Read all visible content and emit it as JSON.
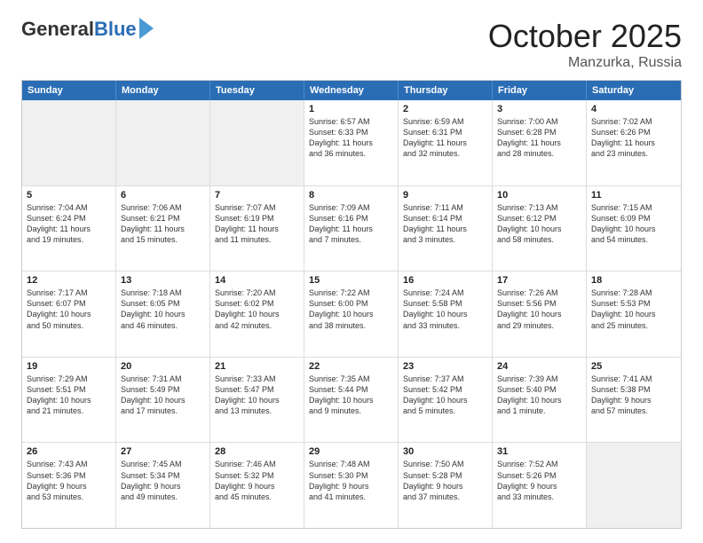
{
  "header": {
    "logo_general": "General",
    "logo_blue": "Blue",
    "title": "October 2025",
    "location": "Manzurka, Russia"
  },
  "weekdays": [
    "Sunday",
    "Monday",
    "Tuesday",
    "Wednesday",
    "Thursday",
    "Friday",
    "Saturday"
  ],
  "weeks": [
    [
      {
        "day": "",
        "text": "",
        "shaded": true
      },
      {
        "day": "",
        "text": "",
        "shaded": true
      },
      {
        "day": "",
        "text": "",
        "shaded": true
      },
      {
        "day": "1",
        "text": "Sunrise: 6:57 AM\nSunset: 6:33 PM\nDaylight: 11 hours\nand 36 minutes."
      },
      {
        "day": "2",
        "text": "Sunrise: 6:59 AM\nSunset: 6:31 PM\nDaylight: 11 hours\nand 32 minutes."
      },
      {
        "day": "3",
        "text": "Sunrise: 7:00 AM\nSunset: 6:28 PM\nDaylight: 11 hours\nand 28 minutes."
      },
      {
        "day": "4",
        "text": "Sunrise: 7:02 AM\nSunset: 6:26 PM\nDaylight: 11 hours\nand 23 minutes."
      }
    ],
    [
      {
        "day": "5",
        "text": "Sunrise: 7:04 AM\nSunset: 6:24 PM\nDaylight: 11 hours\nand 19 minutes."
      },
      {
        "day": "6",
        "text": "Sunrise: 7:06 AM\nSunset: 6:21 PM\nDaylight: 11 hours\nand 15 minutes."
      },
      {
        "day": "7",
        "text": "Sunrise: 7:07 AM\nSunset: 6:19 PM\nDaylight: 11 hours\nand 11 minutes."
      },
      {
        "day": "8",
        "text": "Sunrise: 7:09 AM\nSunset: 6:16 PM\nDaylight: 11 hours\nand 7 minutes."
      },
      {
        "day": "9",
        "text": "Sunrise: 7:11 AM\nSunset: 6:14 PM\nDaylight: 11 hours\nand 3 minutes."
      },
      {
        "day": "10",
        "text": "Sunrise: 7:13 AM\nSunset: 6:12 PM\nDaylight: 10 hours\nand 58 minutes."
      },
      {
        "day": "11",
        "text": "Sunrise: 7:15 AM\nSunset: 6:09 PM\nDaylight: 10 hours\nand 54 minutes."
      }
    ],
    [
      {
        "day": "12",
        "text": "Sunrise: 7:17 AM\nSunset: 6:07 PM\nDaylight: 10 hours\nand 50 minutes."
      },
      {
        "day": "13",
        "text": "Sunrise: 7:18 AM\nSunset: 6:05 PM\nDaylight: 10 hours\nand 46 minutes."
      },
      {
        "day": "14",
        "text": "Sunrise: 7:20 AM\nSunset: 6:02 PM\nDaylight: 10 hours\nand 42 minutes."
      },
      {
        "day": "15",
        "text": "Sunrise: 7:22 AM\nSunset: 6:00 PM\nDaylight: 10 hours\nand 38 minutes."
      },
      {
        "day": "16",
        "text": "Sunrise: 7:24 AM\nSunset: 5:58 PM\nDaylight: 10 hours\nand 33 minutes."
      },
      {
        "day": "17",
        "text": "Sunrise: 7:26 AM\nSunset: 5:56 PM\nDaylight: 10 hours\nand 29 minutes."
      },
      {
        "day": "18",
        "text": "Sunrise: 7:28 AM\nSunset: 5:53 PM\nDaylight: 10 hours\nand 25 minutes."
      }
    ],
    [
      {
        "day": "19",
        "text": "Sunrise: 7:29 AM\nSunset: 5:51 PM\nDaylight: 10 hours\nand 21 minutes."
      },
      {
        "day": "20",
        "text": "Sunrise: 7:31 AM\nSunset: 5:49 PM\nDaylight: 10 hours\nand 17 minutes."
      },
      {
        "day": "21",
        "text": "Sunrise: 7:33 AM\nSunset: 5:47 PM\nDaylight: 10 hours\nand 13 minutes."
      },
      {
        "day": "22",
        "text": "Sunrise: 7:35 AM\nSunset: 5:44 PM\nDaylight: 10 hours\nand 9 minutes."
      },
      {
        "day": "23",
        "text": "Sunrise: 7:37 AM\nSunset: 5:42 PM\nDaylight: 10 hours\nand 5 minutes."
      },
      {
        "day": "24",
        "text": "Sunrise: 7:39 AM\nSunset: 5:40 PM\nDaylight: 10 hours\nand 1 minute."
      },
      {
        "day": "25",
        "text": "Sunrise: 7:41 AM\nSunset: 5:38 PM\nDaylight: 9 hours\nand 57 minutes."
      }
    ],
    [
      {
        "day": "26",
        "text": "Sunrise: 7:43 AM\nSunset: 5:36 PM\nDaylight: 9 hours\nand 53 minutes."
      },
      {
        "day": "27",
        "text": "Sunrise: 7:45 AM\nSunset: 5:34 PM\nDaylight: 9 hours\nand 49 minutes."
      },
      {
        "day": "28",
        "text": "Sunrise: 7:46 AM\nSunset: 5:32 PM\nDaylight: 9 hours\nand 45 minutes."
      },
      {
        "day": "29",
        "text": "Sunrise: 7:48 AM\nSunset: 5:30 PM\nDaylight: 9 hours\nand 41 minutes."
      },
      {
        "day": "30",
        "text": "Sunrise: 7:50 AM\nSunset: 5:28 PM\nDaylight: 9 hours\nand 37 minutes."
      },
      {
        "day": "31",
        "text": "Sunrise: 7:52 AM\nSunset: 5:26 PM\nDaylight: 9 hours\nand 33 minutes."
      },
      {
        "day": "",
        "text": "",
        "shaded": true
      }
    ]
  ]
}
